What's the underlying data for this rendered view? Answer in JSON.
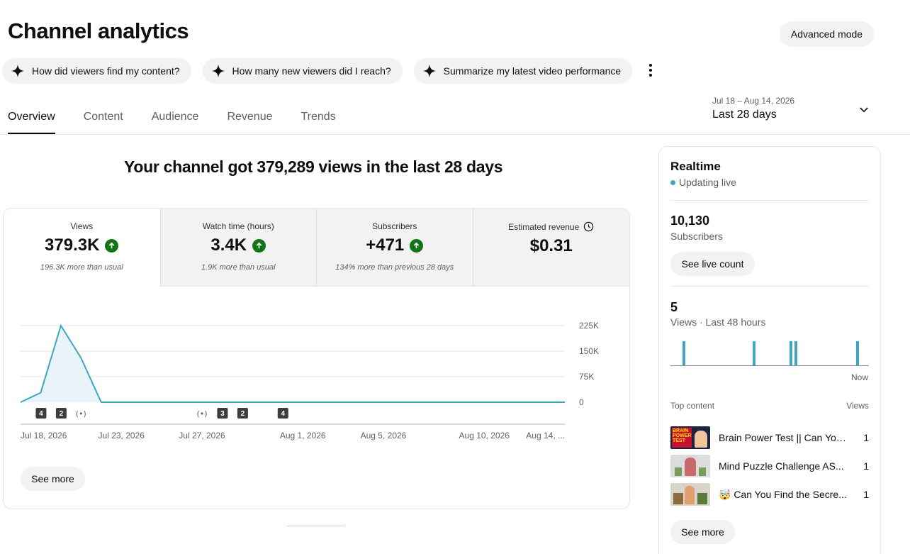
{
  "page": {
    "title": "Channel analytics",
    "advanced_mode": "Advanced mode"
  },
  "chips": [
    {
      "label": "How did viewers find my content?"
    },
    {
      "label": "How many new viewers did I reach?"
    },
    {
      "label": "Summarize my latest video performance"
    }
  ],
  "tabs": [
    "Overview",
    "Content",
    "Audience",
    "Revenue",
    "Trends"
  ],
  "date_range": {
    "dates": "Jul 18 – Aug 14, 2026",
    "label": "Last 28 days"
  },
  "headline": "Your channel got 379,289 views in the last 28 days",
  "metrics": [
    {
      "label": "Views",
      "value": "379.3K",
      "sub": "196.3K more than usual"
    },
    {
      "label": "Watch time (hours)",
      "value": "3.4K",
      "sub": "1.9K more than usual"
    },
    {
      "label": "Subscribers",
      "value": "+471",
      "sub": "134% more than previous 28 days"
    },
    {
      "label": "Estimated revenue",
      "value": "$0.31",
      "sub": ""
    }
  ],
  "chart_data": {
    "type": "area",
    "ylabel": "",
    "y_ticks": [
      "225K",
      "150K",
      "75K",
      "0"
    ],
    "ylim": [
      0,
      225000
    ],
    "x_tick_labels": [
      "Jul 18, 2026",
      "Jul 23, 2026",
      "Jul 27, 2026",
      "Aug 1, 2026",
      "Aug 5, 2026",
      "Aug 10, 2026",
      "Aug 14, ..."
    ],
    "x": [
      "Jul 18",
      "Jul 19",
      "Jul 20",
      "Jul 21",
      "Jul 22",
      "Jul 23",
      "Jul 24",
      "Jul 25",
      "Jul 26",
      "Jul 27",
      "Jul 28",
      "Jul 29",
      "Jul 30",
      "Jul 31",
      "Aug 1",
      "Aug 2",
      "Aug 3",
      "Aug 4",
      "Aug 5",
      "Aug 6",
      "Aug 7",
      "Aug 8",
      "Aug 9",
      "Aug 10",
      "Aug 11",
      "Aug 12",
      "Aug 13",
      "Aug 14"
    ],
    "values": [
      0,
      28000,
      225000,
      130000,
      0,
      0,
      0,
      0,
      0,
      0,
      0,
      0,
      0,
      0,
      0,
      0,
      0,
      0,
      0,
      0,
      0,
      0,
      0,
      0,
      0,
      0,
      0,
      0
    ],
    "markers": [
      {
        "day": "Jul 19",
        "label": "4"
      },
      {
        "day": "Jul 20",
        "label": "2"
      },
      {
        "day": "Jul 21",
        "label": "live"
      },
      {
        "day": "Jul 27",
        "label": "live"
      },
      {
        "day": "Jul 28",
        "label": "3"
      },
      {
        "day": "Jul 29",
        "label": "2"
      },
      {
        "day": "Jul 31",
        "label": "4"
      }
    ],
    "color": "#3ea6c2"
  },
  "chart_see_more": "See more",
  "realtime": {
    "title": "Realtime",
    "status": "Updating live",
    "subscribers_value": "10,130",
    "subscribers_label": "Subscribers",
    "live_count_button": "See live count",
    "views_value": "5",
    "views_label": "Views · Last 48 hours",
    "now_label": "Now",
    "bar_values": [
      1,
      1,
      1,
      1,
      1
    ],
    "top_content_label": "Top content",
    "views_col_label": "Views",
    "top_content": [
      {
        "title": "Brain Power Test || Can You...",
        "views": "1",
        "thumb_text": "BRAIN POWER TEST"
      },
      {
        "title": "Mind Puzzle Challenge AS...",
        "views": "1"
      },
      {
        "title": "🤯 Can You Find the Secre...",
        "views": "1"
      }
    ],
    "see_more": "See more"
  }
}
